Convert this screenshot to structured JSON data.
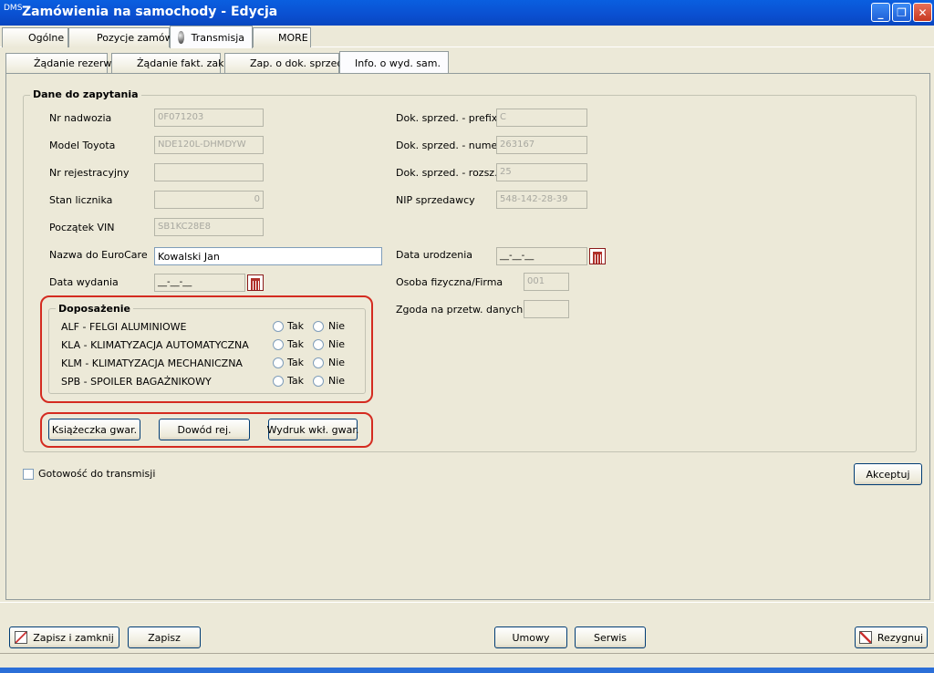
{
  "window": {
    "title": "Zamówienia na samochody - Edycja",
    "icon_text": "DMS",
    "controls": {
      "minimize": "_",
      "restore": "❐",
      "close": "✕"
    }
  },
  "tabs_main": [
    {
      "label": "Ogólne"
    },
    {
      "label": "Pozycje zamów."
    },
    {
      "label": "Transmisja",
      "active": true
    },
    {
      "label": "MORE"
    }
  ],
  "tabs_sub": [
    {
      "label": "Żądanie rezerw."
    },
    {
      "label": "Żądanie fakt. zak."
    },
    {
      "label": "Zap. o dok. sprzed."
    },
    {
      "label": "Info. o wyd. sam.",
      "active": true
    }
  ],
  "group_main": {
    "title": "Dane do zapytania",
    "left_fields": [
      {
        "label": "Nr nadwozia",
        "value": "0F071203"
      },
      {
        "label": "Model Toyota",
        "value": "NDE120L-DHMDYW"
      },
      {
        "label": "Nr rejestracyjny",
        "value": ""
      },
      {
        "label": "Stan licznika",
        "value": "0"
      },
      {
        "label": "Początek VIN",
        "value": "SB1KC28E8"
      },
      {
        "label": "Nazwa do EuroCare",
        "value": "Kowalski Jan"
      },
      {
        "label": "Data wydania",
        "value": "__-__-__"
      }
    ],
    "right_fields": [
      {
        "label": "Dok. sprzed. - prefix",
        "value": "C"
      },
      {
        "label": "Dok. sprzed. - numer",
        "value": "263167"
      },
      {
        "label": "Dok. sprzed. - rozsz.",
        "value": "25"
      },
      {
        "label": "NIP sprzedawcy",
        "value": "548-142-28-39"
      },
      {
        "label": "Data urodzenia",
        "value": "__-__-__"
      },
      {
        "label": "Osoba fizyczna/Firma",
        "value": "001"
      },
      {
        "label": "Zgoda na przetw. danych",
        "value": ""
      }
    ]
  },
  "equipment": {
    "title": "Doposażenie",
    "yes_label": "Tak",
    "no_label": "Nie",
    "items": [
      {
        "label": "ALF - FELGI ALUMINIOWE"
      },
      {
        "label": "KLA - KLIMATYZACJA AUTOMATYCZNA"
      },
      {
        "label": "KLM - KLIMATYZACJA MECHANICZNA"
      },
      {
        "label": "SPB - SPOILER BAGAŻNIKOWY"
      }
    ]
  },
  "doc_buttons": {
    "warranty_book": "Książeczka gwar.",
    "registration": "Dowód rej.",
    "print_insert": "Wydruk wkł. gwar."
  },
  "ready_checkbox_label": "Gotowość do transmisji",
  "accept_button": "Akceptuj",
  "footer": {
    "save_close": "Zapisz i zamknij",
    "save": "Zapisz",
    "contracts": "Umowy",
    "service": "Serwis",
    "cancel": "Rezygnuj"
  },
  "colors": {
    "titlebar": "#0a5fe0",
    "highlight_red": "#d42b20",
    "window_bg": "#ece9d8"
  }
}
